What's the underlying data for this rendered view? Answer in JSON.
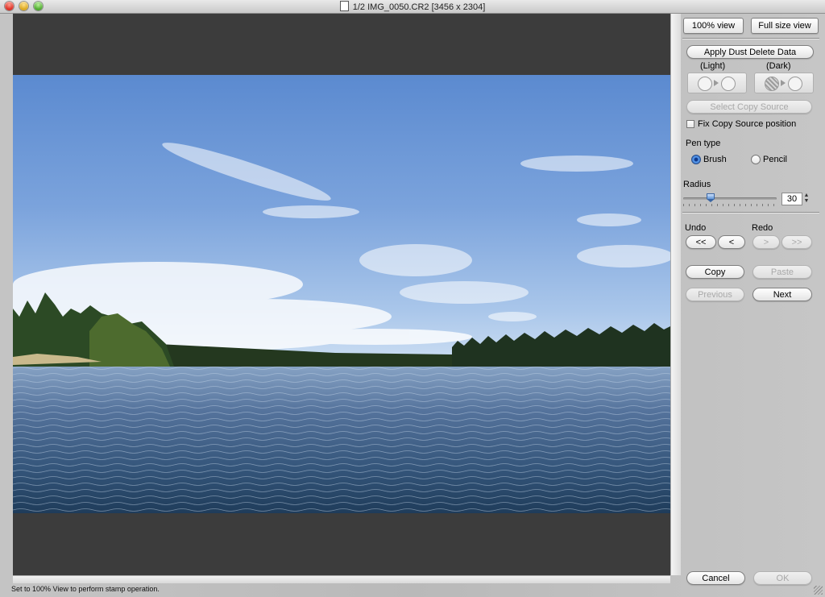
{
  "window": {
    "title": "1/2 IMG_0050.CR2 [3456 x 2304]"
  },
  "view_buttons": {
    "view_100": "100% view",
    "full_size": "Full size view"
  },
  "dust": {
    "apply_label": "Apply Dust Delete Data",
    "light_label": "(Light)",
    "dark_label": "(Dark)",
    "select_copy_source": "Select Copy Source",
    "fix_copy_source": "Fix Copy Source position",
    "fix_copy_source_checked": false
  },
  "pen": {
    "label": "Pen type",
    "options": [
      "Brush",
      "Pencil"
    ],
    "selected": "Brush"
  },
  "radius": {
    "label": "Radius",
    "value": "30"
  },
  "history": {
    "undo_label": "Undo",
    "redo_label": "Redo",
    "undo_all": "<<",
    "undo_one": "<",
    "redo_one": ">",
    "redo_all": ">>"
  },
  "clipboard": {
    "copy": "Copy",
    "paste": "Paste"
  },
  "navigation": {
    "previous": "Previous",
    "next": "Next"
  },
  "dialog": {
    "cancel": "Cancel",
    "ok": "OK"
  },
  "status": {
    "message": "Set to 100% View to perform stamp operation."
  },
  "colors": {
    "sky_top": "#5b8ad0",
    "water_dark": "#203e5c",
    "canvas_bg": "#3c3c3c",
    "forest": "#1f3320"
  }
}
